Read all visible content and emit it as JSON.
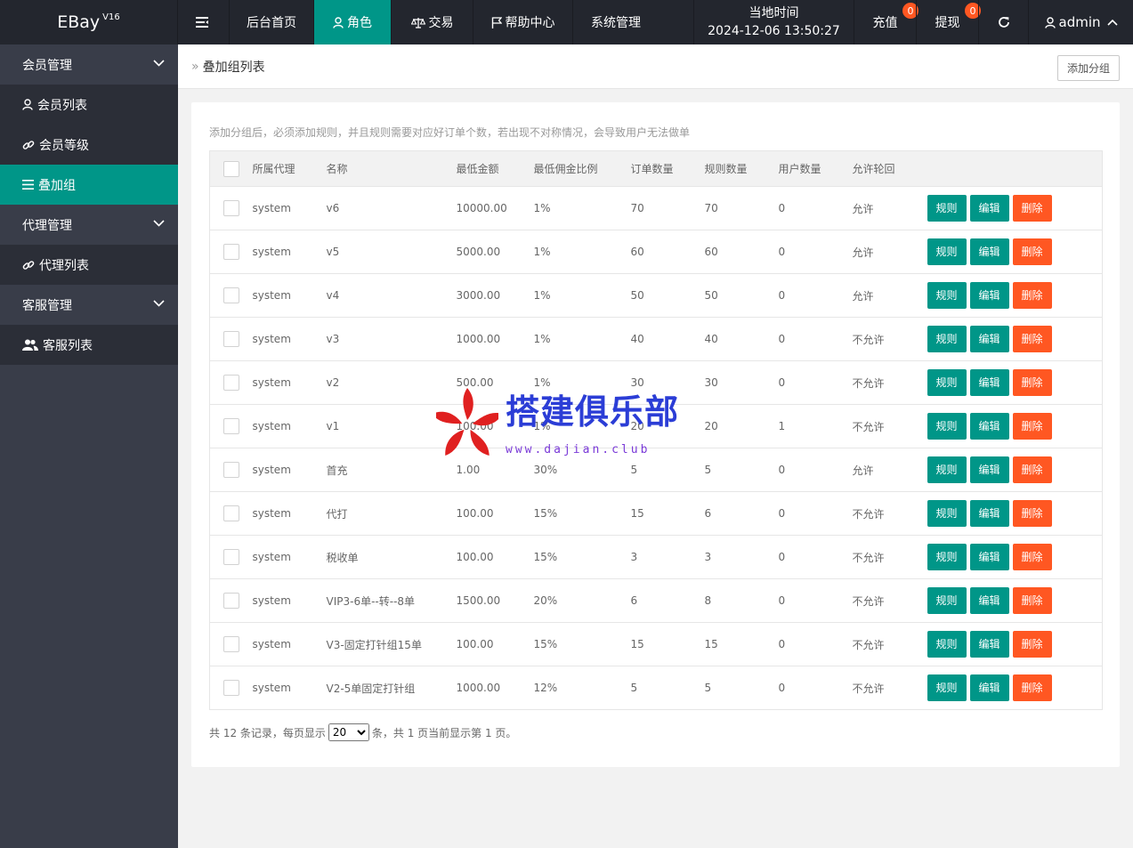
{
  "brand": {
    "name": "EBay",
    "version": "V16"
  },
  "topnav": [
    {
      "label": "",
      "icon": "menu-toggle-icon"
    },
    {
      "label": "后台首页"
    },
    {
      "label": "角色",
      "icon": "user-icon",
      "active": true
    },
    {
      "label": "交易",
      "icon": "scale-icon"
    },
    {
      "label": "帮助中心",
      "icon": "flag-icon"
    },
    {
      "label": "系统管理"
    }
  ],
  "clock": {
    "title": "当地时间",
    "value": "2024-12-06 13:50:27"
  },
  "recharge": {
    "label": "充值",
    "badge": "0"
  },
  "withdraw": {
    "label": "提现",
    "badge": "0"
  },
  "user": {
    "name": "admin"
  },
  "sidebar": {
    "groups": [
      {
        "label": "会员管理",
        "items": [
          {
            "label": "会员列表",
            "icon": "user-icon"
          },
          {
            "label": "会员等级",
            "icon": "link-icon"
          },
          {
            "label": "叠加组",
            "icon": "list-icon",
            "active": true
          }
        ]
      },
      {
        "label": "代理管理",
        "items": [
          {
            "label": "代理列表",
            "icon": "link-icon"
          }
        ]
      },
      {
        "label": "客服管理",
        "items": [
          {
            "label": "客服列表",
            "icon": "users-icon"
          }
        ]
      }
    ]
  },
  "breadcrumb": {
    "sep": "»",
    "title": "叠加组列表"
  },
  "add_button": "添加分组",
  "tip": "添加分组后，必须添加规则，并且规则需要对应好订单个数，若出现不对称情况，会导致用户无法做单",
  "table": {
    "headers": [
      "所属代理",
      "名称",
      "最低金额",
      "最低佣金比例",
      "订单数量",
      "规则数量",
      "用户数量",
      "允许轮回"
    ],
    "actions": {
      "rule": "规则",
      "edit": "编辑",
      "delete": "删除"
    },
    "rows": [
      {
        "agent": "system",
        "name": "v6",
        "min_amount": "10000.00",
        "rate": "1%",
        "orders": "70",
        "rules": "70",
        "users": "0",
        "cycle": "允许"
      },
      {
        "agent": "system",
        "name": "v5",
        "min_amount": "5000.00",
        "rate": "1%",
        "orders": "60",
        "rules": "60",
        "users": "0",
        "cycle": "允许"
      },
      {
        "agent": "system",
        "name": "v4",
        "min_amount": "3000.00",
        "rate": "1%",
        "orders": "50",
        "rules": "50",
        "users": "0",
        "cycle": "允许"
      },
      {
        "agent": "system",
        "name": "v3",
        "min_amount": "1000.00",
        "rate": "1%",
        "orders": "40",
        "rules": "40",
        "users": "0",
        "cycle": "不允许"
      },
      {
        "agent": "system",
        "name": "v2",
        "min_amount": "500.00",
        "rate": "1%",
        "orders": "30",
        "rules": "30",
        "users": "0",
        "cycle": "不允许"
      },
      {
        "agent": "system",
        "name": "v1",
        "min_amount": "100.00",
        "rate": "1%",
        "orders": "20",
        "rules": "20",
        "users": "1",
        "cycle": "不允许"
      },
      {
        "agent": "system",
        "name": "首充",
        "min_amount": "1.00",
        "rate": "30%",
        "orders": "5",
        "rules": "5",
        "users": "0",
        "cycle": "允许"
      },
      {
        "agent": "system",
        "name": "代打",
        "min_amount": "100.00",
        "rate": "15%",
        "orders": "15",
        "rules": "6",
        "users": "0",
        "cycle": "不允许"
      },
      {
        "agent": "system",
        "name": "税收单",
        "min_amount": "100.00",
        "rate": "15%",
        "orders": "3",
        "rules": "3",
        "users": "0",
        "cycle": "不允许"
      },
      {
        "agent": "system",
        "name": "VIP3-6单--转--8单",
        "min_amount": "1500.00",
        "rate": "20%",
        "orders": "6",
        "rules": "8",
        "users": "0",
        "cycle": "不允许"
      },
      {
        "agent": "system",
        "name": "V3-固定打针组15单",
        "min_amount": "100.00",
        "rate": "15%",
        "orders": "15",
        "rules": "15",
        "users": "0",
        "cycle": "不允许"
      },
      {
        "agent": "system",
        "name": "V2-5单固定打针组",
        "min_amount": "1000.00",
        "rate": "12%",
        "orders": "5",
        "rules": "5",
        "users": "0",
        "cycle": "不允许"
      }
    ]
  },
  "pager": {
    "prefix": "共 12 条记录，每页显示",
    "page_size": "20",
    "suffix": "条，共 1 页当前显示第 1 页。"
  },
  "watermark": {
    "text": "搭建俱乐部",
    "url": "www.dajian.club"
  },
  "colors": {
    "accent": "#009688",
    "danger": "#ff5722",
    "header_bg": "#23262e",
    "sidebar_bg": "#393d49"
  }
}
